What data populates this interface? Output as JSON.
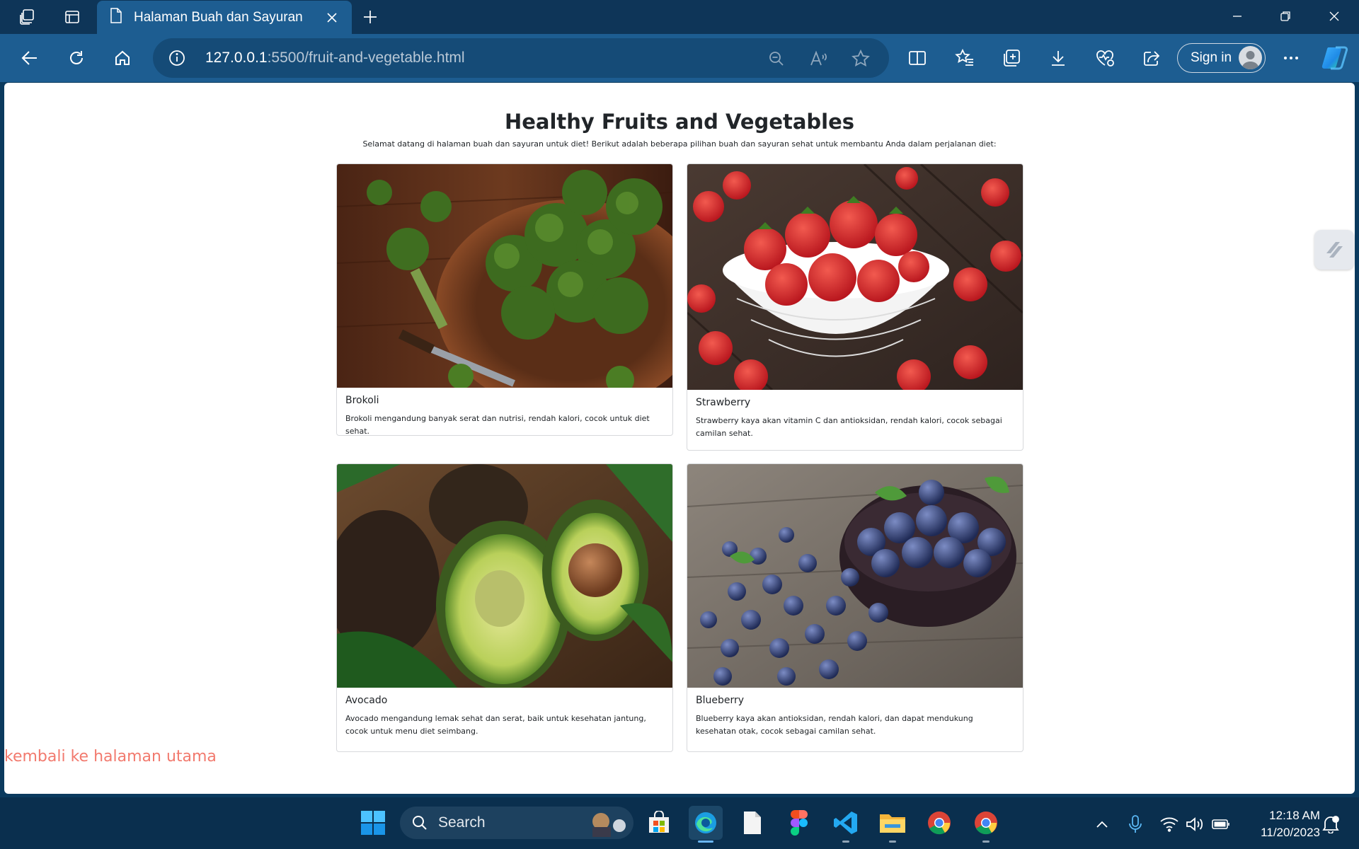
{
  "browser": {
    "tab_title": "Halaman Buah dan Sayuran",
    "url_host": "127.0.0.1",
    "url_rest": ":5500/fruit-and-vegetable.html",
    "sign_in_label": "Sign in"
  },
  "page": {
    "title": "Healthy Fruits and Vegetables",
    "intro": "Selamat datang di halaman buah dan sayuran untuk diet! Berikut adalah beberapa pilihan buah dan sayuran sehat untuk membantu Anda dalam perjalanan diet:",
    "cards": [
      {
        "name": "Brokoli",
        "description": "Brokoli mengandung banyak serat dan nutrisi, rendah kalori, cocok untuk diet sehat.",
        "image": "broccoli-photo"
      },
      {
        "name": "Strawberry",
        "description": "Strawberry kaya akan vitamin C dan antioksidan, rendah kalori, cocok sebagai camilan sehat.",
        "image": "strawberry-photo"
      },
      {
        "name": "Avocado",
        "description": "Avocado mengandung lemak sehat dan serat, baik untuk kesehatan jantung, cocok untuk menu diet seimbang.",
        "image": "avocado-photo"
      },
      {
        "name": "Blueberry",
        "description": "Blueberry kaya akan antioksidan, rendah kalori, dan dapat mendukung kesehatan otak, cocok sebagai camilan sehat.",
        "image": "blueberry-photo"
      }
    ],
    "back_link": "kembali ke halaman utama",
    "link_color": "#f27a6e"
  },
  "taskbar": {
    "search_label": "Search",
    "time": "12:18 AM",
    "date": "11/20/2023"
  },
  "colors": {
    "titlebar": "#0e3558",
    "toolbar": "#1d5d91",
    "taskbar": "#0a2f4e"
  }
}
